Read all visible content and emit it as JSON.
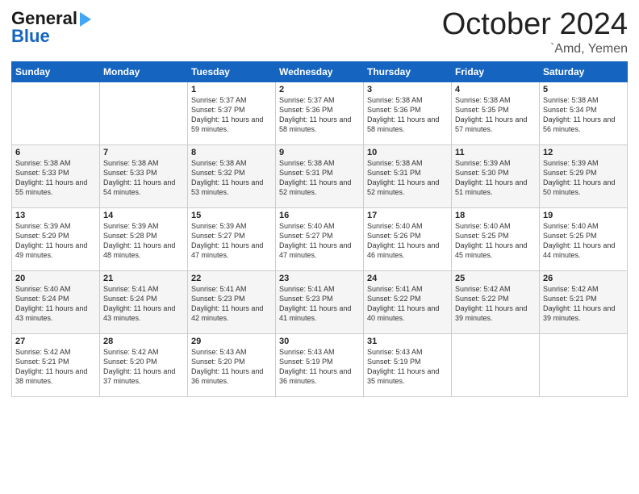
{
  "logo": {
    "line1": "General",
    "line2": "Blue"
  },
  "title": "October 2024",
  "location": "`Amd, Yemen",
  "days_of_week": [
    "Sunday",
    "Monday",
    "Tuesday",
    "Wednesday",
    "Thursday",
    "Friday",
    "Saturday"
  ],
  "weeks": [
    [
      {
        "day": "",
        "sunrise": "",
        "sunset": "",
        "daylight": ""
      },
      {
        "day": "",
        "sunrise": "",
        "sunset": "",
        "daylight": ""
      },
      {
        "day": "1",
        "sunrise": "Sunrise: 5:37 AM",
        "sunset": "Sunset: 5:37 PM",
        "daylight": "Daylight: 11 hours and 59 minutes."
      },
      {
        "day": "2",
        "sunrise": "Sunrise: 5:37 AM",
        "sunset": "Sunset: 5:36 PM",
        "daylight": "Daylight: 11 hours and 58 minutes."
      },
      {
        "day": "3",
        "sunrise": "Sunrise: 5:38 AM",
        "sunset": "Sunset: 5:36 PM",
        "daylight": "Daylight: 11 hours and 58 minutes."
      },
      {
        "day": "4",
        "sunrise": "Sunrise: 5:38 AM",
        "sunset": "Sunset: 5:35 PM",
        "daylight": "Daylight: 11 hours and 57 minutes."
      },
      {
        "day": "5",
        "sunrise": "Sunrise: 5:38 AM",
        "sunset": "Sunset: 5:34 PM",
        "daylight": "Daylight: 11 hours and 56 minutes."
      }
    ],
    [
      {
        "day": "6",
        "sunrise": "Sunrise: 5:38 AM",
        "sunset": "Sunset: 5:33 PM",
        "daylight": "Daylight: 11 hours and 55 minutes."
      },
      {
        "day": "7",
        "sunrise": "Sunrise: 5:38 AM",
        "sunset": "Sunset: 5:33 PM",
        "daylight": "Daylight: 11 hours and 54 minutes."
      },
      {
        "day": "8",
        "sunrise": "Sunrise: 5:38 AM",
        "sunset": "Sunset: 5:32 PM",
        "daylight": "Daylight: 11 hours and 53 minutes."
      },
      {
        "day": "9",
        "sunrise": "Sunrise: 5:38 AM",
        "sunset": "Sunset: 5:31 PM",
        "daylight": "Daylight: 11 hours and 52 minutes."
      },
      {
        "day": "10",
        "sunrise": "Sunrise: 5:38 AM",
        "sunset": "Sunset: 5:31 PM",
        "daylight": "Daylight: 11 hours and 52 minutes."
      },
      {
        "day": "11",
        "sunrise": "Sunrise: 5:39 AM",
        "sunset": "Sunset: 5:30 PM",
        "daylight": "Daylight: 11 hours and 51 minutes."
      },
      {
        "day": "12",
        "sunrise": "Sunrise: 5:39 AM",
        "sunset": "Sunset: 5:29 PM",
        "daylight": "Daylight: 11 hours and 50 minutes."
      }
    ],
    [
      {
        "day": "13",
        "sunrise": "Sunrise: 5:39 AM",
        "sunset": "Sunset: 5:29 PM",
        "daylight": "Daylight: 11 hours and 49 minutes."
      },
      {
        "day": "14",
        "sunrise": "Sunrise: 5:39 AM",
        "sunset": "Sunset: 5:28 PM",
        "daylight": "Daylight: 11 hours and 48 minutes."
      },
      {
        "day": "15",
        "sunrise": "Sunrise: 5:39 AM",
        "sunset": "Sunset: 5:27 PM",
        "daylight": "Daylight: 11 hours and 47 minutes."
      },
      {
        "day": "16",
        "sunrise": "Sunrise: 5:40 AM",
        "sunset": "Sunset: 5:27 PM",
        "daylight": "Daylight: 11 hours and 47 minutes."
      },
      {
        "day": "17",
        "sunrise": "Sunrise: 5:40 AM",
        "sunset": "Sunset: 5:26 PM",
        "daylight": "Daylight: 11 hours and 46 minutes."
      },
      {
        "day": "18",
        "sunrise": "Sunrise: 5:40 AM",
        "sunset": "Sunset: 5:25 PM",
        "daylight": "Daylight: 11 hours and 45 minutes."
      },
      {
        "day": "19",
        "sunrise": "Sunrise: 5:40 AM",
        "sunset": "Sunset: 5:25 PM",
        "daylight": "Daylight: 11 hours and 44 minutes."
      }
    ],
    [
      {
        "day": "20",
        "sunrise": "Sunrise: 5:40 AM",
        "sunset": "Sunset: 5:24 PM",
        "daylight": "Daylight: 11 hours and 43 minutes."
      },
      {
        "day": "21",
        "sunrise": "Sunrise: 5:41 AM",
        "sunset": "Sunset: 5:24 PM",
        "daylight": "Daylight: 11 hours and 43 minutes."
      },
      {
        "day": "22",
        "sunrise": "Sunrise: 5:41 AM",
        "sunset": "Sunset: 5:23 PM",
        "daylight": "Daylight: 11 hours and 42 minutes."
      },
      {
        "day": "23",
        "sunrise": "Sunrise: 5:41 AM",
        "sunset": "Sunset: 5:23 PM",
        "daylight": "Daylight: 11 hours and 41 minutes."
      },
      {
        "day": "24",
        "sunrise": "Sunrise: 5:41 AM",
        "sunset": "Sunset: 5:22 PM",
        "daylight": "Daylight: 11 hours and 40 minutes."
      },
      {
        "day": "25",
        "sunrise": "Sunrise: 5:42 AM",
        "sunset": "Sunset: 5:22 PM",
        "daylight": "Daylight: 11 hours and 39 minutes."
      },
      {
        "day": "26",
        "sunrise": "Sunrise: 5:42 AM",
        "sunset": "Sunset: 5:21 PM",
        "daylight": "Daylight: 11 hours and 39 minutes."
      }
    ],
    [
      {
        "day": "27",
        "sunrise": "Sunrise: 5:42 AM",
        "sunset": "Sunset: 5:21 PM",
        "daylight": "Daylight: 11 hours and 38 minutes."
      },
      {
        "day": "28",
        "sunrise": "Sunrise: 5:42 AM",
        "sunset": "Sunset: 5:20 PM",
        "daylight": "Daylight: 11 hours and 37 minutes."
      },
      {
        "day": "29",
        "sunrise": "Sunrise: 5:43 AM",
        "sunset": "Sunset: 5:20 PM",
        "daylight": "Daylight: 11 hours and 36 minutes."
      },
      {
        "day": "30",
        "sunrise": "Sunrise: 5:43 AM",
        "sunset": "Sunset: 5:19 PM",
        "daylight": "Daylight: 11 hours and 36 minutes."
      },
      {
        "day": "31",
        "sunrise": "Sunrise: 5:43 AM",
        "sunset": "Sunset: 5:19 PM",
        "daylight": "Daylight: 11 hours and 35 minutes."
      },
      {
        "day": "",
        "sunrise": "",
        "sunset": "",
        "daylight": ""
      },
      {
        "day": "",
        "sunrise": "",
        "sunset": "",
        "daylight": ""
      }
    ]
  ]
}
